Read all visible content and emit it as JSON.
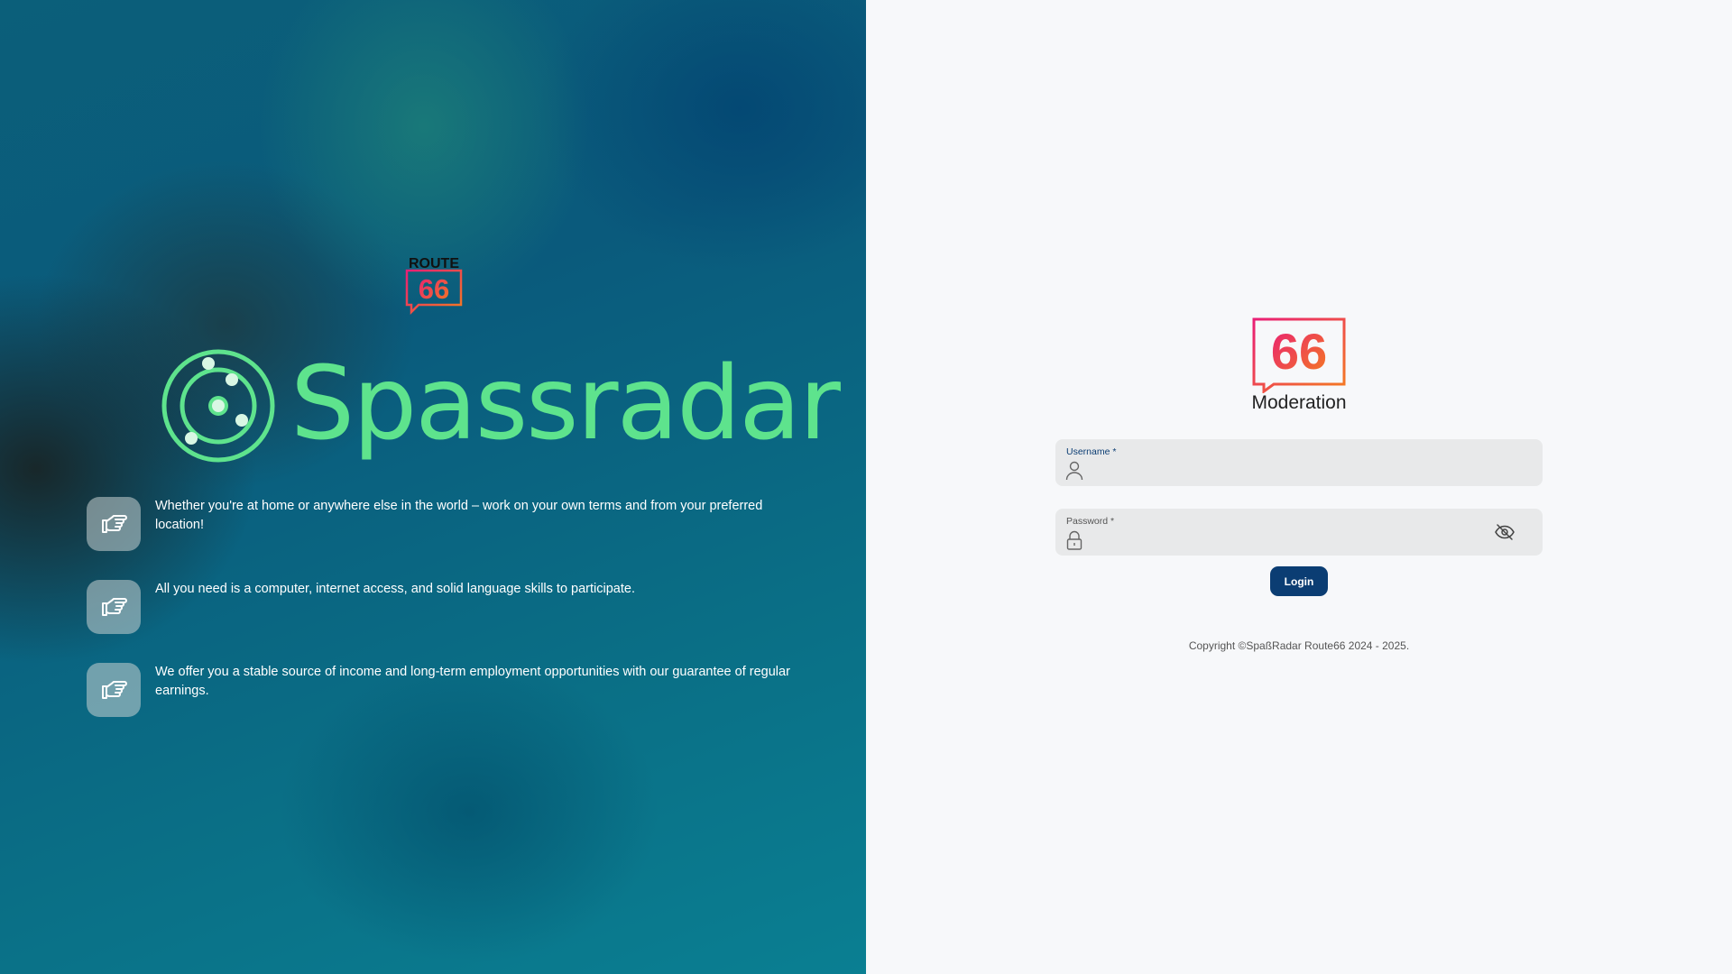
{
  "left": {
    "route_logo": {
      "top": "ROUTE",
      "number": "66"
    },
    "brand_name": "Spassradar",
    "features": [
      {
        "icon": "pointing-hand-icon",
        "text": "Whether you're at home or anywhere else in the world – work on your own terms and from your preferred location!"
      },
      {
        "icon": "pointing-hand-icon",
        "text": "All you need is a computer, internet access, and solid language skills to participate."
      },
      {
        "icon": "pointing-hand-icon",
        "text": "We offer you a stable source of income and long-term employment opportunities with our guarantee of regular earnings."
      }
    ],
    "colors": {
      "brand_green": "#5ee38d"
    }
  },
  "login": {
    "logo_number": "66",
    "title": "Moderation",
    "username": {
      "label": "Username *",
      "value": "",
      "icon": "user-icon"
    },
    "password": {
      "label": "Password *",
      "value": "",
      "icon": "lock-icon",
      "toggle_icon": "eye-off-icon"
    },
    "login_label": "Login",
    "copyright": "Copyright ©SpaßRadar Route66 2024 - 2025.",
    "colors": {
      "primary": "#0b3d73",
      "gradient_start": "#e91e75",
      "gradient_end": "#f47b20"
    }
  }
}
